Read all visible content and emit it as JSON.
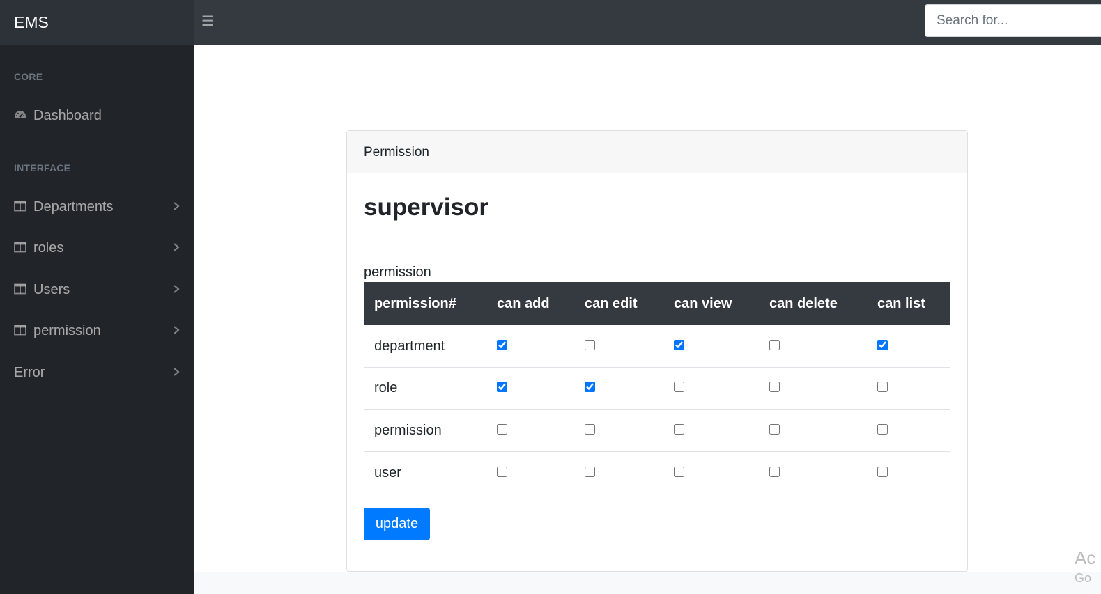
{
  "app": {
    "brand": "EMS"
  },
  "search": {
    "placeholder": "Search for..."
  },
  "sidebar": {
    "headings": [
      "CORE",
      "INTERFACE"
    ],
    "items": [
      {
        "label": "Dashboard",
        "icon": "dashboard-gauge-icon",
        "has_chevron": false
      },
      {
        "label": "Departments",
        "icon": "columns-icon",
        "has_chevron": true
      },
      {
        "label": "roles",
        "icon": "columns-icon",
        "has_chevron": true
      },
      {
        "label": "Users",
        "icon": "columns-icon",
        "has_chevron": true
      },
      {
        "label": "permission",
        "icon": "columns-icon",
        "has_chevron": true
      },
      {
        "label": "Error",
        "icon": null,
        "has_chevron": true
      }
    ]
  },
  "card": {
    "header": "Permission",
    "role_name": "supervisor",
    "section_label": "permission",
    "table": {
      "columns": [
        "permission#",
        "can add",
        "can edit",
        "can view",
        "can delete",
        "can list"
      ],
      "rows": [
        {
          "name": "department",
          "checks": [
            true,
            false,
            true,
            false,
            true
          ]
        },
        {
          "name": "role",
          "checks": [
            true,
            true,
            false,
            false,
            false
          ]
        },
        {
          "name": "permission",
          "checks": [
            false,
            false,
            false,
            false,
            false
          ]
        },
        {
          "name": "user",
          "checks": [
            false,
            false,
            false,
            false,
            false
          ]
        }
      ]
    },
    "button": "update"
  },
  "watermark": {
    "line1": "Ac",
    "line2": "Go"
  },
  "colors": {
    "topbar": "#343a40",
    "sidebar": "#212529",
    "primary": "#007bff",
    "table_header": "#343a40"
  }
}
